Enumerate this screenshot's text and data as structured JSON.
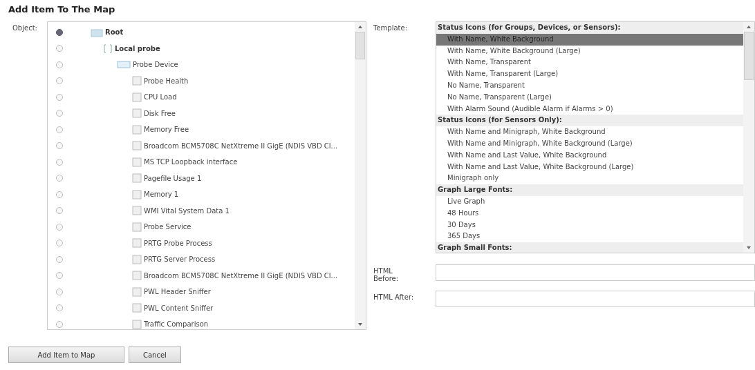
{
  "title": "Add Item To The Map",
  "object": {
    "label": "Object:",
    "tree": [
      {
        "kind": "group",
        "name": "Root",
        "selected": true,
        "children": [
          {
            "kind": "probe",
            "name": "Local probe",
            "selected": false,
            "children": [
              {
                "kind": "device",
                "name": "Probe Device",
                "selected": false,
                "children": [
                  {
                    "kind": "sensor",
                    "name": "Probe Health",
                    "selected": false
                  },
                  {
                    "kind": "sensor",
                    "name": "CPU Load",
                    "selected": false
                  },
                  {
                    "kind": "sensor",
                    "name": "Disk Free",
                    "selected": false
                  },
                  {
                    "kind": "sensor",
                    "name": "Memory Free",
                    "selected": false
                  },
                  {
                    "kind": "sensor",
                    "name": "Broadcom BCM5708C NetXtreme II GigE (NDIS VBD Cl...",
                    "selected": false
                  },
                  {
                    "kind": "sensor",
                    "name": "MS TCP Loopback interface",
                    "selected": false
                  },
                  {
                    "kind": "sensor",
                    "name": "Pagefile Usage 1",
                    "selected": false
                  },
                  {
                    "kind": "sensor",
                    "name": "Memory 1",
                    "selected": false
                  },
                  {
                    "kind": "sensor",
                    "name": "WMI Vital System Data 1",
                    "selected": false
                  },
                  {
                    "kind": "sensor",
                    "name": "Probe Service",
                    "selected": false
                  },
                  {
                    "kind": "sensor",
                    "name": "PRTG Probe Process",
                    "selected": false
                  },
                  {
                    "kind": "sensor",
                    "name": "PRTG Server Process",
                    "selected": false
                  },
                  {
                    "kind": "sensor",
                    "name": "Broadcom BCM5708C NetXtreme II GigE (NDIS VBD Cl...",
                    "selected": false
                  },
                  {
                    "kind": "sensor",
                    "name": "PWL Header Sniffer",
                    "selected": false
                  },
                  {
                    "kind": "sensor",
                    "name": "PWL Content Sniffer",
                    "selected": false
                  },
                  {
                    "kind": "sensor",
                    "name": "Traffic Comparison",
                    "selected": false
                  }
                ]
              }
            ]
          }
        ]
      }
    ]
  },
  "template": {
    "label": "Template:",
    "groups": [
      {
        "heading": "Status Icons (for Groups, Devices, or Sensors):",
        "options": [
          {
            "label": "With Name, White Background",
            "selected": true
          },
          {
            "label": "With Name, White Background (Large)",
            "selected": false
          },
          {
            "label": "With Name, Transparent",
            "selected": false
          },
          {
            "label": "With Name, Transparent (Large)",
            "selected": false
          },
          {
            "label": "No Name, Transparent",
            "selected": false
          },
          {
            "label": "No Name, Transparent (Large)",
            "selected": false
          },
          {
            "label": "With Alarm Sound (Audible Alarm if Alarms > 0)",
            "selected": false
          }
        ]
      },
      {
        "heading": "Status Icons (for Sensors Only):",
        "options": [
          {
            "label": "With Name and Minigraph, White Background",
            "selected": false
          },
          {
            "label": "With Name and Minigraph, White Background (Large)",
            "selected": false
          },
          {
            "label": "With Name and Last Value, White Background",
            "selected": false
          },
          {
            "label": "With Name and Last Value, White Background (Large)",
            "selected": false
          },
          {
            "label": "Minigraph only",
            "selected": false
          }
        ]
      },
      {
        "heading": "Graph Large Fonts:",
        "options": [
          {
            "label": "Live Graph",
            "selected": false
          },
          {
            "label": "48 Hours",
            "selected": false
          },
          {
            "label": "30 Days",
            "selected": false
          },
          {
            "label": "365 Days",
            "selected": false
          }
        ]
      },
      {
        "heading": "Graph Small Fonts:"
      }
    ]
  },
  "html_before": {
    "label": "HTML Before:"
  },
  "html_after": {
    "label": "HTML After:"
  },
  "buttons": [
    "Add Item to Map",
    "Cancel"
  ]
}
